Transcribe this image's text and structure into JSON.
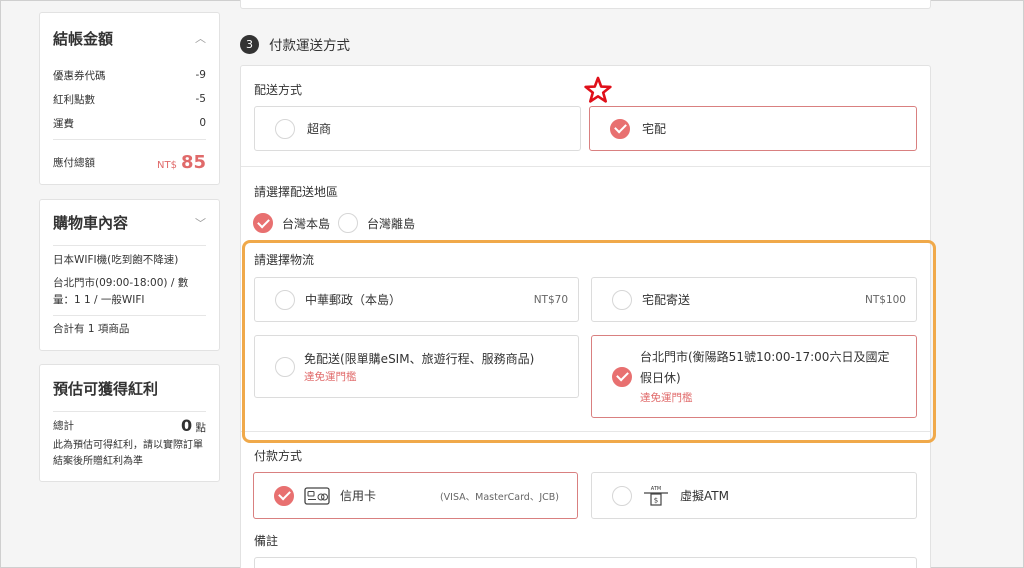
{
  "sidebar": {
    "checkout": {
      "title": "結帳金額",
      "rows": [
        {
          "label": "優惠券代碼",
          "value": "-9"
        },
        {
          "label": "紅利點數",
          "value": "-5"
        },
        {
          "label": "運費",
          "value": "0"
        }
      ],
      "total_label": "應付總額",
      "total_currency": "NT$",
      "total_value": "85"
    },
    "cart": {
      "title": "購物車內容",
      "item_name": "日本WIFI機(吃到飽不降速)",
      "item_detail": "台北門市(09:00-18:00) / 數量：1 1 / 一般WIFI",
      "summary": "合計有 1 項商品"
    },
    "points": {
      "title": "預估可獲得紅利",
      "total_label": "總計",
      "total_value": "0",
      "total_unit": "點",
      "note": "此為預估可得紅利，請以實際訂單結案後所贈紅利為準"
    }
  },
  "main": {
    "step_number": "3",
    "step_title": "付款運送方式",
    "delivery": {
      "label": "配送方式",
      "options": [
        {
          "label": "超商",
          "selected": false
        },
        {
          "label": "宅配",
          "selected": true
        }
      ]
    },
    "region": {
      "label": "請選擇配送地區",
      "options": [
        {
          "label": "台灣本島",
          "selected": true
        },
        {
          "label": "台灣離島",
          "selected": false
        }
      ]
    },
    "logistics": {
      "label": "請選擇物流",
      "options": [
        {
          "label": "中華郵政（本島）",
          "price": "NT$70",
          "note": "",
          "selected": false
        },
        {
          "label": "宅配寄送",
          "price": "NT$100",
          "note": "",
          "selected": false
        },
        {
          "label": "免配送(限單購eSIM、旅遊行程、服務商品)",
          "price": "",
          "note": "達免運門檻",
          "selected": false
        },
        {
          "label_line1": "台北門市(衡陽路51號10:00-17:00六日及國定",
          "label_line2": "假日休)",
          "price": "",
          "note": "達免運門檻",
          "selected": true
        }
      ]
    },
    "payment": {
      "label": "付款方式",
      "options": [
        {
          "label": "信用卡",
          "detail": "(VISA、MasterCard、JCB)",
          "icon": "credit-card-icon",
          "selected": true
        },
        {
          "label": "虛擬ATM",
          "icon_text": "ATM",
          "icon": "atm-icon",
          "selected": false
        }
      ]
    },
    "notes_label": "備註"
  },
  "colors": {
    "accent": "#e87070",
    "highlight_border": "#f0a94a",
    "star": "#e0101a"
  }
}
